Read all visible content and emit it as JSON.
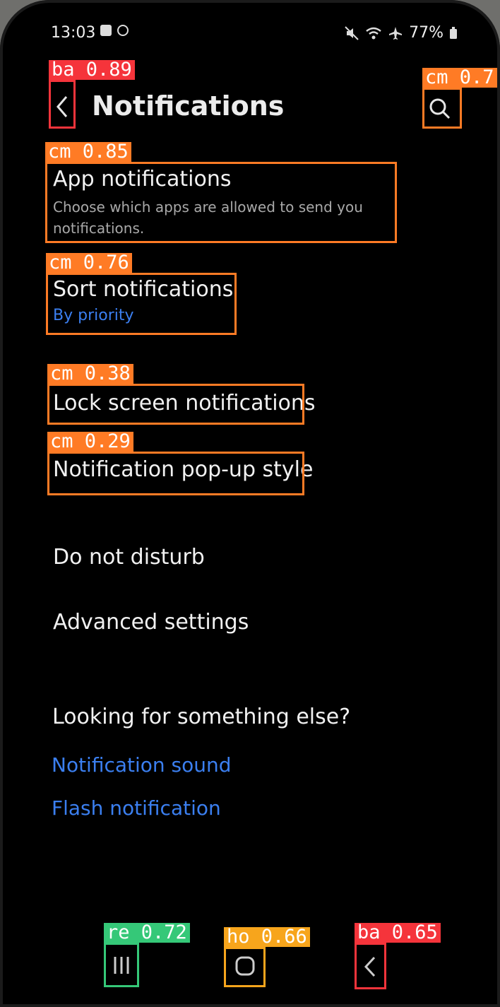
{
  "status_bar": {
    "time": "13:03",
    "battery": "77%",
    "icons": [
      "checkbox-icon",
      "circle-icon",
      "mute-icon",
      "wifi-icon",
      "airplane-icon",
      "battery-icon"
    ]
  },
  "header": {
    "title": "Notifications"
  },
  "items": {
    "app_notifications": {
      "title": "App notifications",
      "subtitle_line1": "Choose which apps are allowed to send you",
      "subtitle_line2": "notifications."
    },
    "sort_notifications": {
      "title": "Sort notifications",
      "value": "By priority"
    },
    "lock_screen": {
      "title": "Lock screen notifications"
    },
    "popup_style": {
      "title": "Notification pop-up style"
    },
    "dnd": {
      "title": "Do not disturb"
    },
    "advanced": {
      "title": "Advanced settings"
    }
  },
  "looking": {
    "heading": "Looking for something else?",
    "link1": "Notification sound",
    "link2": "Flash notification"
  },
  "annotations": {
    "back_top": "ba 0.89",
    "search": "cm 0.7",
    "app_notifications": "cm 0.85",
    "sort_notifications": "cm 0.76",
    "lock_screen": "cm 0.38",
    "popup_style": "cm 0.29",
    "recents": "re 0.72",
    "home": "ho 0.66",
    "back_bottom": "ba 0.65"
  },
  "colors": {
    "orange": "#ff7b25",
    "red": "#f5343b",
    "green": "#35c878",
    "amber": "#f7a51c",
    "link_blue": "#3b7ff0"
  }
}
